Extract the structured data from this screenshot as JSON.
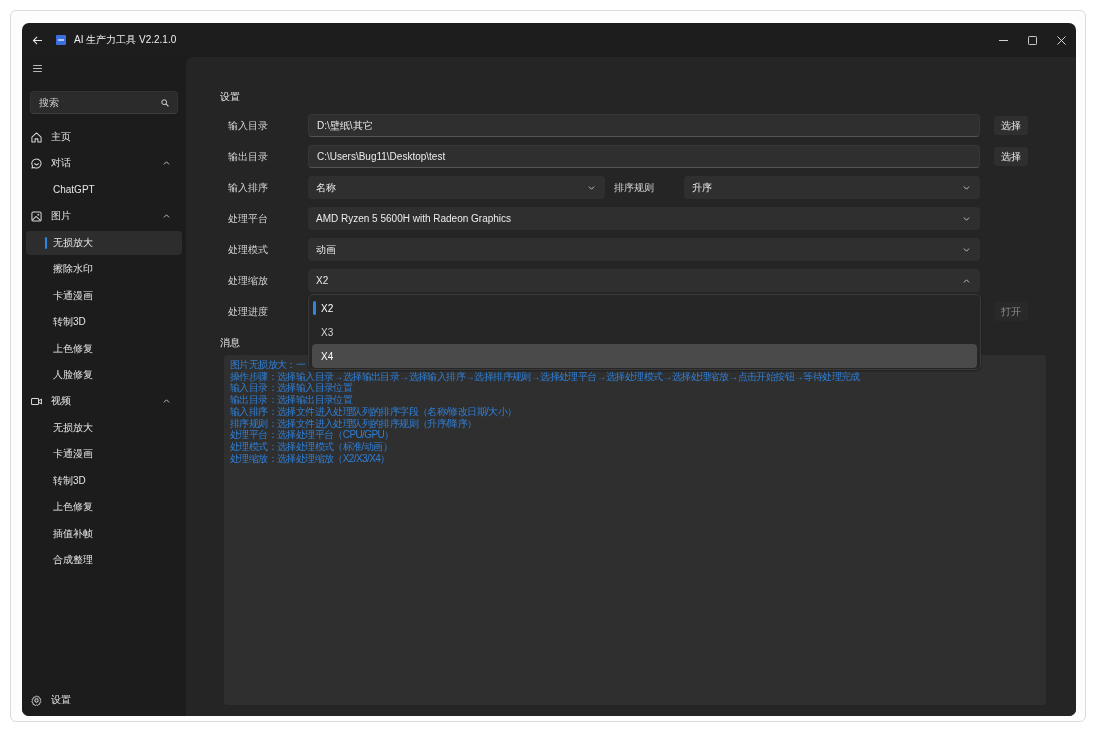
{
  "window": {
    "title": "AI 生产力工具 V2.2.1.0"
  },
  "sidebar": {
    "search": {
      "placeholder": "搜索"
    },
    "items": [
      {
        "label": "主页",
        "selected": false
      },
      {
        "label": "对话",
        "selected": false,
        "expanded": true,
        "children": [
          {
            "label": "ChatGPT",
            "selected": false
          }
        ]
      },
      {
        "label": "图片",
        "selected": false,
        "expanded": true,
        "children": [
          {
            "label": "无损放大",
            "selected": true
          },
          {
            "label": "擦除水印",
            "selected": false
          },
          {
            "label": "卡通漫画",
            "selected": false
          },
          {
            "label": "转制3D",
            "selected": false
          },
          {
            "label": "上色修复",
            "selected": false
          },
          {
            "label": "人脸修复",
            "selected": false
          }
        ]
      },
      {
        "label": "视频",
        "selected": false,
        "expanded": true,
        "children": [
          {
            "label": "无损放大",
            "selected": false
          },
          {
            "label": "卡通漫画",
            "selected": false
          },
          {
            "label": "转制3D",
            "selected": false
          },
          {
            "label": "上色修复",
            "selected": false
          },
          {
            "label": "插值补帧",
            "selected": false
          },
          {
            "label": "合成整理",
            "selected": false
          }
        ]
      }
    ],
    "footer": {
      "label": "设置"
    }
  },
  "settings": {
    "title": "设置",
    "rows": [
      {
        "kind": "path",
        "label": "输入目录",
        "value": "D:\\壁纸\\其它",
        "button": {
          "label": "选择",
          "disabled": false
        }
      },
      {
        "kind": "path",
        "label": "输出目录",
        "value": "C:\\Users\\Bug11\\Desktop\\test",
        "button": {
          "label": "选择",
          "disabled": false
        }
      },
      {
        "kind": "pair",
        "label": "输入排序",
        "value": "名称",
        "label_2": "排序规则",
        "value_2": "升序"
      },
      {
        "kind": "select",
        "label": "处理平台",
        "value": "AMD Ryzen 5 5600H with Radeon Graphics",
        "expanded": false
      },
      {
        "kind": "select",
        "label": "处理模式",
        "value": "动画",
        "expanded": false
      },
      {
        "kind": "select",
        "label": "处理缩放",
        "value": "X2",
        "expanded": true,
        "options": [
          {
            "label": "X2",
            "selected": true,
            "hovered": false
          },
          {
            "label": "X3",
            "selected": false,
            "hovered": false
          },
          {
            "label": "X4",
            "selected": false,
            "hovered": true
          }
        ]
      },
      {
        "kind": "progress",
        "label": "处理进度",
        "button": {
          "label": "打开",
          "disabled": true
        }
      }
    ]
  },
  "messages": {
    "title": "消息",
    "lines": [
      "图片无损放大：一",
      "操作步骤：选择输入目录→选择输出目录→选择输入排序→选择排序规则→选择处理平台→选择处理模式→选择处理缩放→点击开始按钮→等待处理完成",
      "输入目录：选择输入目录位置",
      "输出目录：选择输出目录位置",
      "输入排序：选择文件进入处理队列的排序字段（名称/修改日期/大小）",
      "排序规则：选择文件进入处理队列的排序规则（升序/降序）",
      "处理平台：选择处理平台（CPU/GPU）",
      "处理模式：选择处理模式（标准/动画）",
      "处理缩放：选择处理缩放（X2/X3/X4）"
    ]
  }
}
